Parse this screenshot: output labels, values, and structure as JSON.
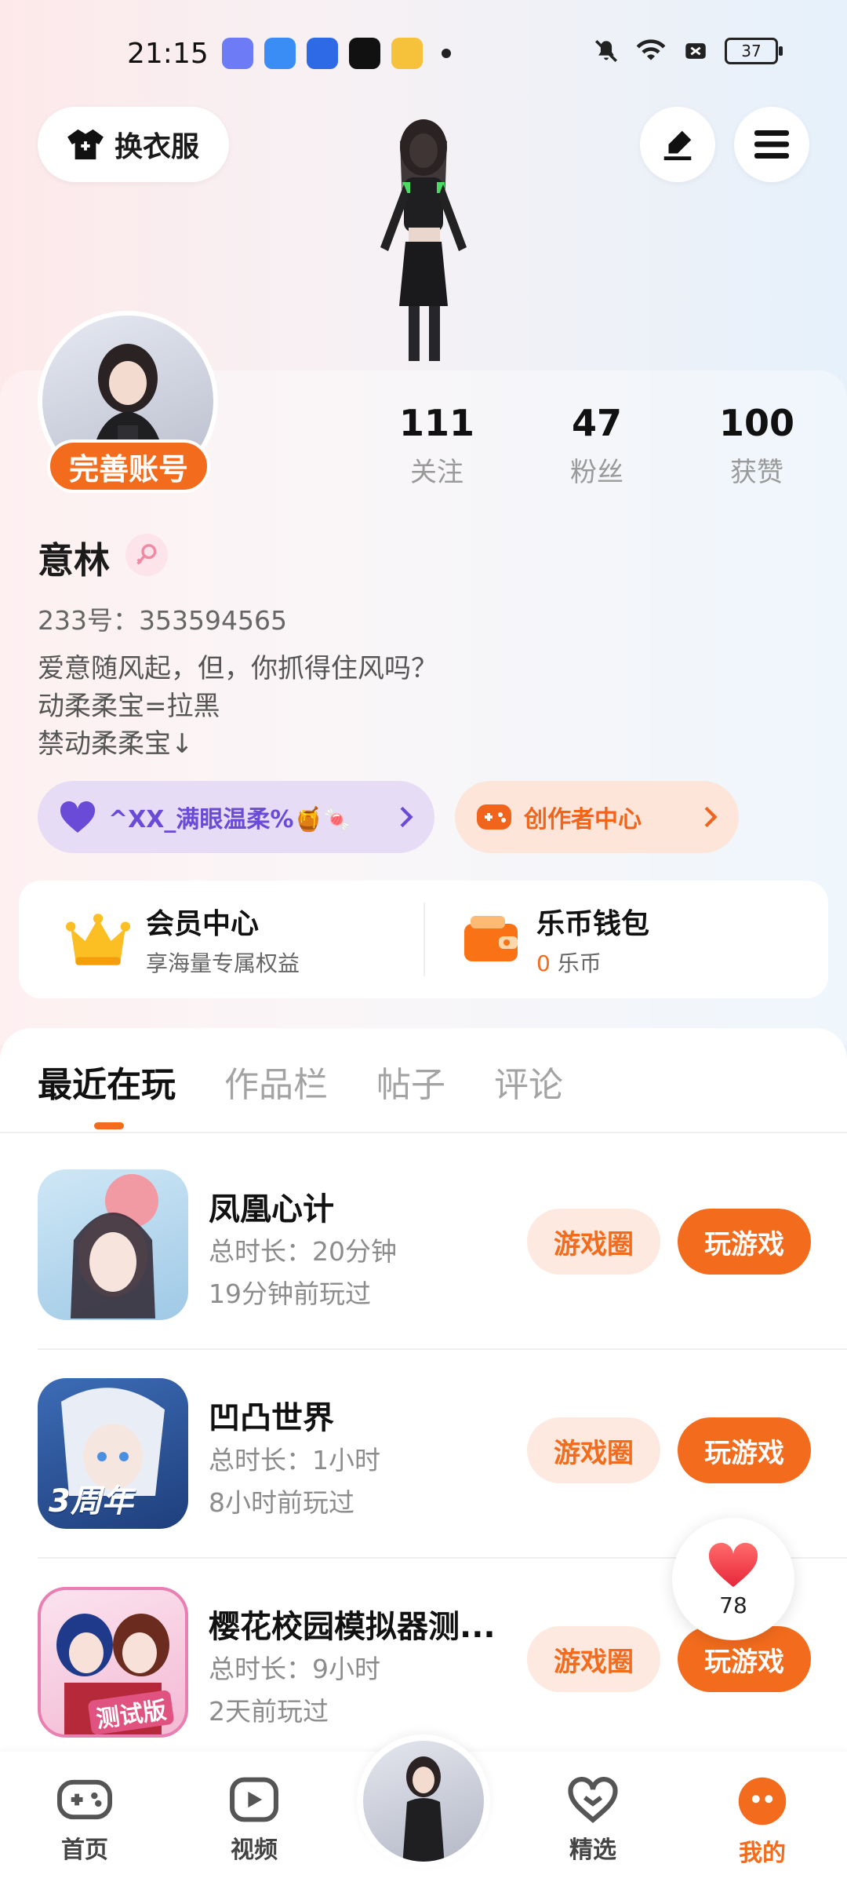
{
  "status": {
    "time": "21:15",
    "battery": "37"
  },
  "top": {
    "outfit_label": "换衣服"
  },
  "profile": {
    "complete_label": "完善账号",
    "stats": [
      {
        "num": "111",
        "label": "关注"
      },
      {
        "num": "47",
        "label": "粉丝"
      },
      {
        "num": "100",
        "label": "获赞"
      }
    ],
    "name": "意林",
    "uid": "233号：353594565",
    "bio": "爱意随风起，但，你抓得住风吗？\n动柔柔宝=拉黑\n禁动柔柔宝↓",
    "guard_label": "^XX_满眼温柔%🍯🍬",
    "creator_label": "创作者中心"
  },
  "vip": {
    "title": "会员中心",
    "sub": "享海量专属权益"
  },
  "wallet": {
    "title": "乐币钱包",
    "amount": "0",
    "unit": "乐币"
  },
  "tabs": [
    "最近在玩",
    "作品栏",
    "帖子",
    "评论"
  ],
  "games": [
    {
      "name": "凤凰心计",
      "duration": "总时长：20分钟",
      "last": "19分钟前玩过"
    },
    {
      "name": "凹凸世界",
      "duration": "总时长：1小时",
      "last": "8小时前玩过"
    },
    {
      "name": "樱花校园模拟器测...",
      "duration": "总时长：9小时",
      "last": "2天前玩过"
    }
  ],
  "buttons": {
    "circle": "游戏圈",
    "play": "玩游戏"
  },
  "badges": {
    "anniversary": "3周年",
    "test": "测试版"
  },
  "like": {
    "count": "78"
  },
  "nav": {
    "home": "首页",
    "video": "视频",
    "featured": "精选",
    "mine": "我的"
  },
  "colors": {
    "accent": "#f36c1d",
    "accent_light": "#fde9df",
    "purple": "#6a4bd8"
  }
}
